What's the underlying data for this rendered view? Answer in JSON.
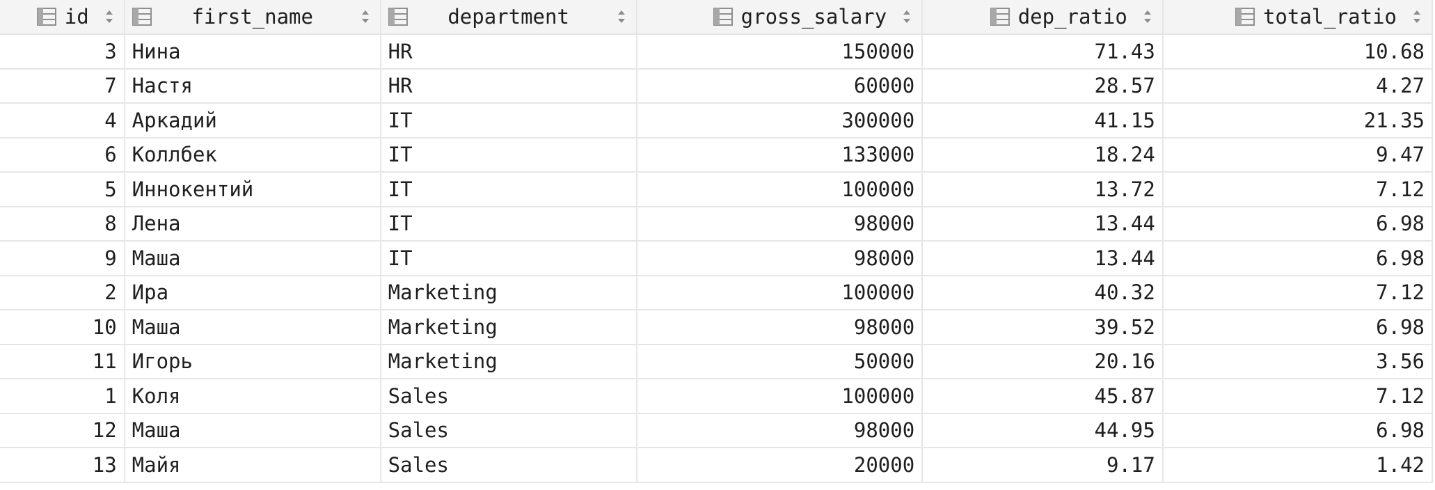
{
  "columns": [
    {
      "label": "id",
      "icon": "table-column-icon"
    },
    {
      "label": "first_name",
      "icon": "table-column-icon"
    },
    {
      "label": "department",
      "icon": "table-column-icon"
    },
    {
      "label": "gross_salary",
      "icon": "table-column-icon"
    },
    {
      "label": "dep_ratio",
      "icon": "table-column-icon"
    },
    {
      "label": "total_ratio",
      "icon": "table-column-icon"
    }
  ],
  "rows": [
    [
      "3",
      "Нина",
      "HR",
      "150000",
      "71.43",
      "10.68"
    ],
    [
      "7",
      "Настя",
      "HR",
      "60000",
      "28.57",
      "4.27"
    ],
    [
      "4",
      "Аркадий",
      "IT",
      "300000",
      "41.15",
      "21.35"
    ],
    [
      "6",
      "Коллбек",
      "IT",
      "133000",
      "18.24",
      "9.47"
    ],
    [
      "5",
      "Иннокентий",
      "IT",
      "100000",
      "13.72",
      "7.12"
    ],
    [
      "8",
      "Лена",
      "IT",
      "98000",
      "13.44",
      "6.98"
    ],
    [
      "9",
      "Маша",
      "IT",
      "98000",
      "13.44",
      "6.98"
    ],
    [
      "2",
      "Ира",
      "Marketing",
      "100000",
      "40.32",
      "7.12"
    ],
    [
      "10",
      "Маша",
      "Marketing",
      "98000",
      "39.52",
      "6.98"
    ],
    [
      "11",
      "Игорь",
      "Marketing",
      "50000",
      "20.16",
      "3.56"
    ],
    [
      "1",
      "Коля",
      "Sales",
      "100000",
      "45.87",
      "7.12"
    ],
    [
      "12",
      "Маша",
      "Sales",
      "98000",
      "44.95",
      "6.98"
    ],
    [
      "13",
      "Майя",
      "Sales",
      "20000",
      "9.17",
      "1.42"
    ]
  ]
}
